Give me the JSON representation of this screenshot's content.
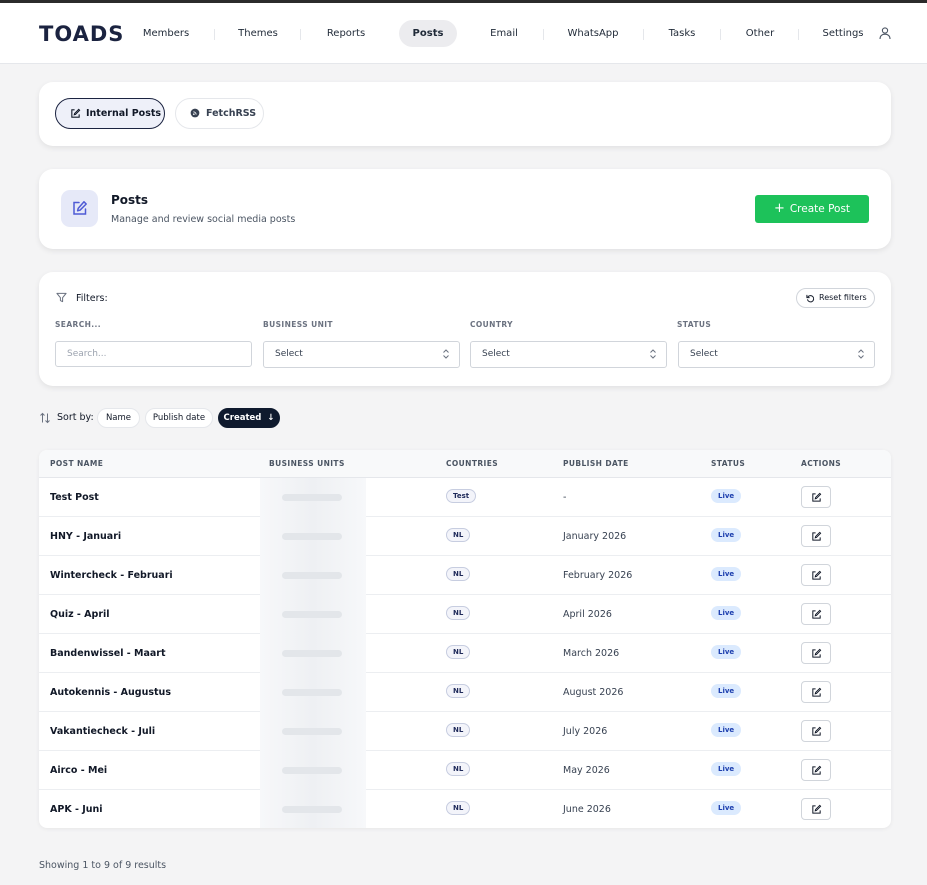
{
  "app": {
    "logo": "TOADS"
  },
  "nav": {
    "items": [
      {
        "label": "Members"
      },
      {
        "label": "Themes"
      },
      {
        "label": "Reports"
      },
      {
        "label": "Posts",
        "active": true
      },
      {
        "label": "Email"
      },
      {
        "label": "WhatsApp"
      },
      {
        "label": "Tasks"
      },
      {
        "label": "Other"
      },
      {
        "label": "Settings"
      }
    ],
    "user_icon": "user-icon"
  },
  "source_tabs": [
    {
      "label": "Internal Posts",
      "icon": "edit-icon",
      "active": true
    },
    {
      "label": "FetchRSS",
      "icon": "rss-circle-icon",
      "active": false
    }
  ],
  "header": {
    "title": "Posts",
    "subtitle": "Manage and review social media posts",
    "icon": "edit-icon",
    "create_button": {
      "prefix": "+",
      "label": "Create Post"
    }
  },
  "filters": {
    "label": "Filters:",
    "reset_label": "Reset filters",
    "search": {
      "label": "SEARCH...",
      "placeholder": "Search..."
    },
    "business_unit": {
      "label": "BUSINESS UNIT",
      "value": "Select"
    },
    "country": {
      "label": "COUNTRY",
      "value": "Select"
    },
    "status": {
      "label": "STATUS",
      "value": "Select"
    }
  },
  "sort": {
    "label": "Sort by:",
    "options": [
      {
        "label": "Name",
        "active": false
      },
      {
        "label": "Publish date",
        "active": false
      },
      {
        "label": "Created",
        "active": true,
        "direction": "↓"
      }
    ]
  },
  "table": {
    "columns": [
      "POST NAME",
      "BUSINESS UNITS",
      "COUNTRIES",
      "PUBLISH DATE",
      "STATUS",
      "ACTIONS"
    ],
    "rows": [
      {
        "name": "Test Post",
        "country": "Test",
        "publish_date": "-",
        "status": "Live"
      },
      {
        "name": "HNY - Januari",
        "country": "NL",
        "publish_date": "January 2026",
        "status": "Live"
      },
      {
        "name": "Wintercheck - Februari",
        "country": "NL",
        "publish_date": "February 2026",
        "status": "Live"
      },
      {
        "name": "Quiz - April",
        "country": "NL",
        "publish_date": "April 2026",
        "status": "Live"
      },
      {
        "name": "Bandenwissel - Maart",
        "country": "NL",
        "publish_date": "March 2026",
        "status": "Live"
      },
      {
        "name": "Autokennis - Augustus",
        "country": "NL",
        "publish_date": "August 2026",
        "status": "Live"
      },
      {
        "name": "Vakantiecheck - Juli",
        "country": "NL",
        "publish_date": "July 2026",
        "status": "Live"
      },
      {
        "name": "Airco - Mei",
        "country": "NL",
        "publish_date": "May 2026",
        "status": "Live"
      },
      {
        "name": "APK - Juni",
        "country": "NL",
        "publish_date": "June 2026",
        "status": "Live"
      }
    ]
  },
  "footer": {
    "results": "Showing 1 to 9 of 9 results"
  },
  "colors": {
    "brand": "#1b2340",
    "primary_action": "#1dc25a",
    "status_live_bg": "#dbeafe",
    "status_live_text": "#1e40af"
  }
}
